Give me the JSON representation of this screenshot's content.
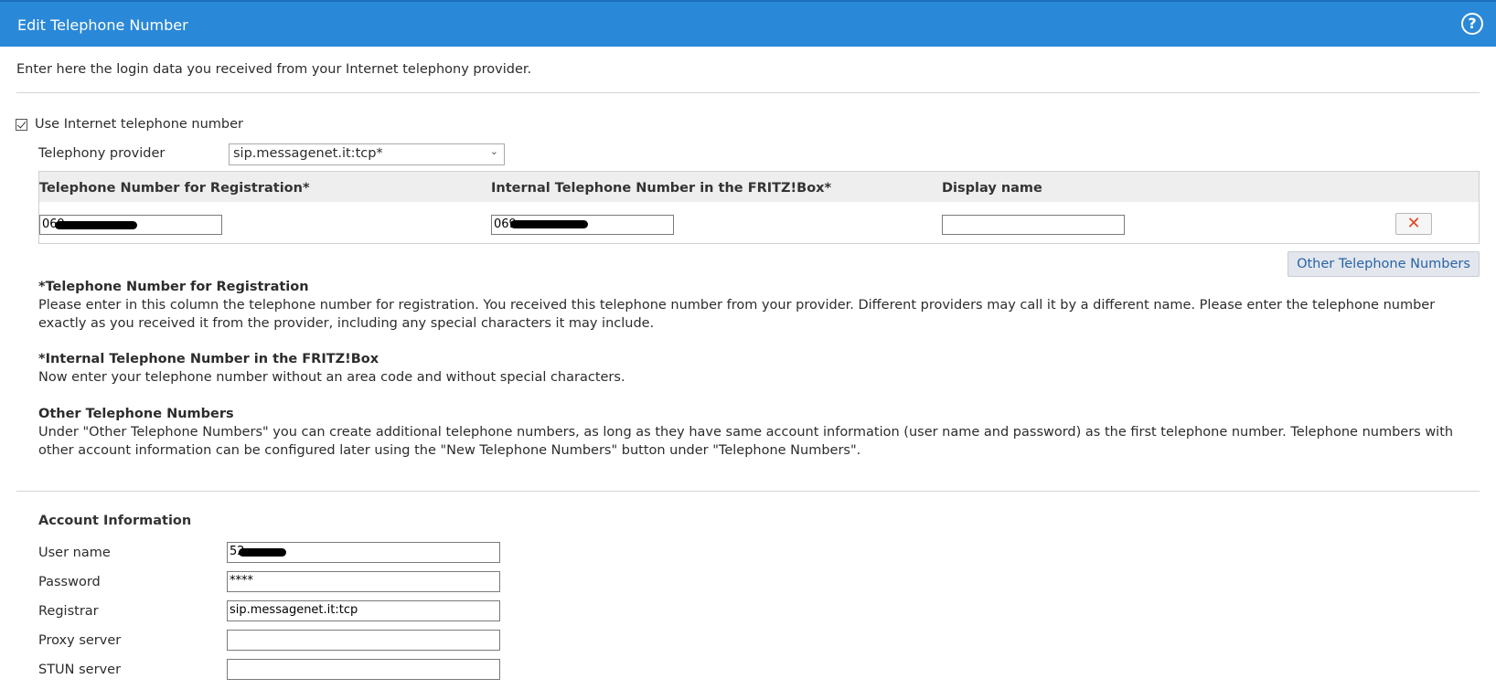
{
  "window": {
    "title": "Edit Telephone Number"
  },
  "intro": "Enter here the login data you received from your Internet telephony provider.",
  "use_internet_number": {
    "label": "Use Internet telephone number",
    "checked": true
  },
  "provider": {
    "label": "Telephony provider",
    "value": "sip.messagenet.it:tcp*"
  },
  "number_table": {
    "headers": [
      "Telephone Number for Registration*",
      "Internal Telephone Number in the FRITZ!Box*",
      "Display name"
    ],
    "row": {
      "registration": "069",
      "internal": "069",
      "display_name": ""
    }
  },
  "other_numbers_button": "Other Telephone Numbers",
  "help": [
    {
      "heading": "*Telephone Number for Registration",
      "text": "Please enter in this column the telephone number for registration. You received this telephone number from your provider. Different providers may call it by a different name. Please enter the telephone number exactly as you received it from the provider, including any special characters it may include."
    },
    {
      "heading": "*Internal Telephone Number in the FRITZ!Box",
      "text": "Now enter your telephone number without an area code and without special characters."
    },
    {
      "heading": "Other Telephone Numbers",
      "text": "Under \"Other Telephone Numbers\" you can create additional telephone numbers, as long as they have same account information (user name and password) as the first telephone number. Telephone numbers with other account information can be configured later using the \"New Telephone Numbers\" button under \"Telephone Numbers\"."
    }
  ],
  "account": {
    "title": "Account Information",
    "fields": [
      {
        "label": "User name",
        "value": "52"
      },
      {
        "label": "Password",
        "value": "****"
      },
      {
        "label": "Registrar",
        "value": "sip.messagenet.it:tcp"
      },
      {
        "label": "Proxy server",
        "value": ""
      },
      {
        "label": "STUN server",
        "value": ""
      }
    ]
  }
}
